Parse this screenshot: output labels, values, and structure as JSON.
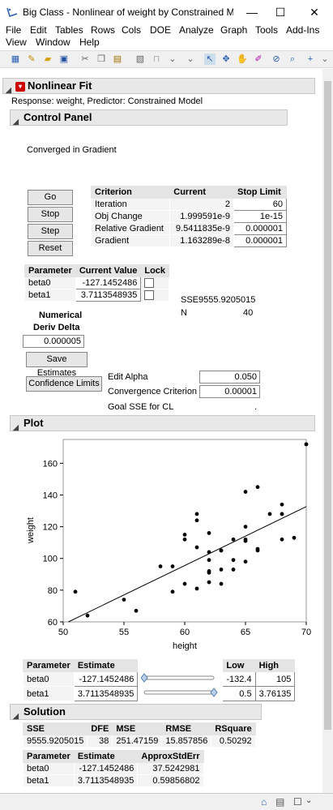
{
  "window": {
    "title": "Big Class - Nonlinear of weight by Constrained M...",
    "minimize": "—",
    "maximize": "☐",
    "close": "✕"
  },
  "menu": {
    "row1": [
      "File",
      "Edit",
      "Tables",
      "Rows",
      "Cols",
      "DOE",
      "Analyze",
      "Graph",
      "Tools",
      "Add-Ins"
    ],
    "row2": [
      "View",
      "Window",
      "Help"
    ]
  },
  "report": {
    "title": "Nonlinear Fit",
    "response_line": "Response: weight, Predictor: Constrained Model",
    "control_panel": {
      "title": "Control Panel",
      "status": "Converged in Gradient",
      "buttons": {
        "go": "Go",
        "stop": "Stop",
        "step": "Step",
        "reset": "Reset"
      },
      "criterion_table": {
        "headers": [
          "Criterion",
          "Current",
          "Stop Limit"
        ],
        "rows": [
          [
            "Iteration",
            "2",
            "60"
          ],
          [
            "Obj Change",
            "1.999591e-9",
            "1e-15"
          ],
          [
            "Relative Gradient",
            "9.5411835e-9",
            "0.000001"
          ],
          [
            "Gradient",
            "1.163289e-8",
            "0.000001"
          ]
        ]
      },
      "param_table": {
        "headers": [
          "Parameter",
          "Current Value",
          "Lock"
        ],
        "rows": [
          [
            "beta0",
            "-127.1452486"
          ],
          [
            "beta1",
            "3.7113548935"
          ]
        ]
      },
      "sse_label": "SSE",
      "sse_value": "9555.9205015",
      "n_label": "N",
      "n_value": "40",
      "deriv_label_1": "Numerical",
      "deriv_label_2": "Deriv Delta",
      "deriv_value": "0.000005",
      "save_estimates": "Save Estimates",
      "confidence_limits": "Confidence Limits",
      "edit_alpha_label": "Edit Alpha",
      "edit_alpha_value": "0.050",
      "conv_label": "Convergence Criterion",
      "conv_value": "0.00001",
      "goal_label": "Goal SSE for CL",
      "goal_value": "."
    },
    "plot": {
      "title": "Plot"
    },
    "slider_table": {
      "headers": [
        "Parameter",
        "Estimate",
        "Low",
        "High"
      ],
      "rows": [
        [
          "beta0",
          "-127.1452486",
          "-132.4",
          "105"
        ],
        [
          "beta1",
          "3.7113548935",
          "0.5",
          "3.76135"
        ]
      ],
      "slider_fraction": [
        0.0,
        1.0
      ]
    },
    "solution": {
      "title": "Solution",
      "fit_headers": [
        "SSE",
        "DFE",
        "MSE",
        "RMSE",
        "RSquare"
      ],
      "fit_values": [
        "9555.9205015",
        "38",
        "251.47159",
        "15.857856",
        "0.50292"
      ],
      "est_headers": [
        "Parameter",
        "Estimate",
        "ApproxStdErr"
      ],
      "est_rows": [
        [
          "beta0",
          "-127.1452486",
          "37.5242981"
        ],
        [
          "beta1",
          "3.7113548935",
          "0.59856802"
        ]
      ]
    }
  },
  "chart_data": {
    "type": "scatter",
    "xlabel": "height",
    "ylabel": "weight",
    "xlim": [
      50,
      70
    ],
    "ylim": [
      60,
      175
    ],
    "xticks": [
      "50",
      "55",
      "60",
      "65",
      "70"
    ],
    "yticks": [
      "60",
      "80",
      "100",
      "120",
      "140",
      "160"
    ],
    "points": [
      [
        51,
        79
      ],
      [
        52,
        64
      ],
      [
        55,
        74
      ],
      [
        56,
        67
      ],
      [
        58,
        95
      ],
      [
        59,
        95
      ],
      [
        59,
        79
      ],
      [
        60,
        84
      ],
      [
        60,
        112
      ],
      [
        60,
        115
      ],
      [
        61,
        107
      ],
      [
        61,
        81
      ],
      [
        61,
        124
      ],
      [
        61,
        128
      ],
      [
        62,
        116
      ],
      [
        62,
        104
      ],
      [
        62,
        92
      ],
      [
        62,
        91
      ],
      [
        62,
        85
      ],
      [
        62,
        99
      ],
      [
        63,
        105
      ],
      [
        63,
        93
      ],
      [
        63,
        84
      ],
      [
        63,
        105
      ],
      [
        64,
        112
      ],
      [
        64,
        99
      ],
      [
        64,
        93
      ],
      [
        65,
        142
      ],
      [
        65,
        112
      ],
      [
        65,
        111
      ],
      [
        65,
        120
      ],
      [
        65,
        98
      ],
      [
        66,
        145
      ],
      [
        66,
        106
      ],
      [
        66,
        105
      ],
      [
        67,
        128
      ],
      [
        68,
        128
      ],
      [
        68,
        134
      ],
      [
        68,
        112
      ],
      [
        69,
        113
      ],
      [
        70,
        172
      ]
    ],
    "fit_line": {
      "intercept": -127.1452486,
      "slope": 3.7113548935
    },
    "grid": false
  },
  "status": {
    "home_icon": "home-icon",
    "window_icon": "window-icon"
  }
}
